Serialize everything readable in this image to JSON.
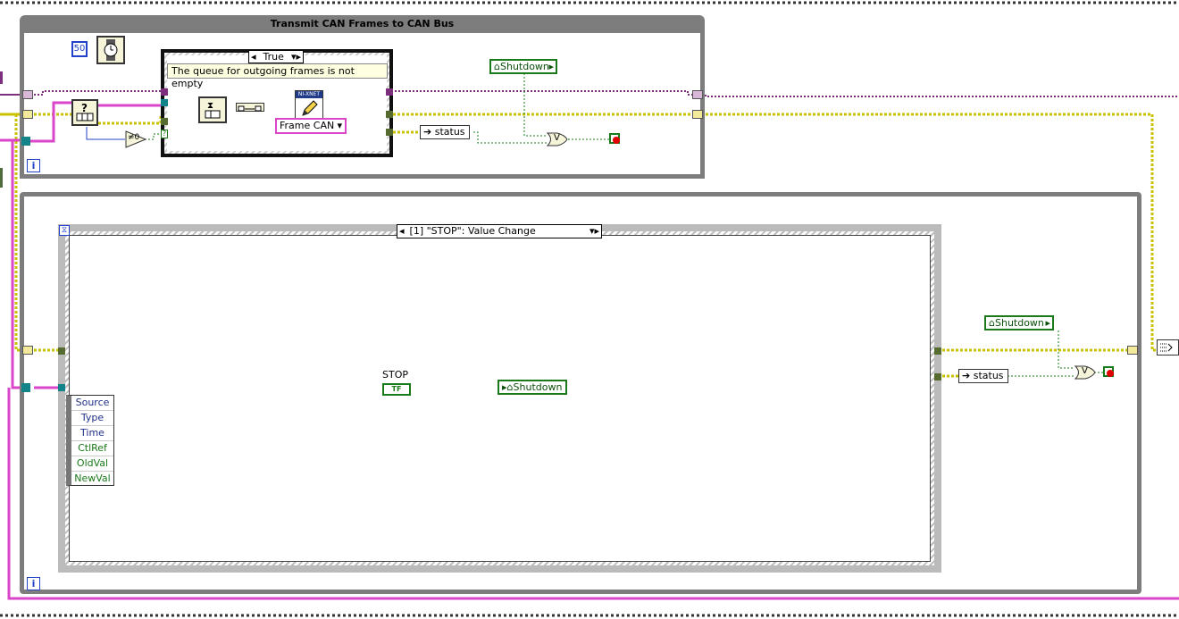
{
  "top_loop": {
    "title": "Transmit CAN Frames to CAN Bus",
    "iteration_label": "i",
    "wait_constant": "50"
  },
  "case_structure": {
    "selector_value": "True",
    "comment": "The queue for outgoing frames is not empty"
  },
  "xnet": {
    "badge": "NI-XNET",
    "mode_selector": "Frame CAN"
  },
  "top_status_label": "status",
  "top_shutdown_label": "Shutdown",
  "compare_label": "≠0",
  "bottom_loop": {
    "iteration_label": "i",
    "event_selector": "[1] \"STOP\": Value Change",
    "stop_caption": "STOP",
    "stop_terminal": "TF",
    "shutdown_local": "Shutdown",
    "event_data": [
      "Source",
      "Type",
      "Time",
      "CtlRef",
      "OldVal",
      "NewVal"
    ]
  },
  "right_shutdown_label": "Shutdown",
  "right_status_label": "status",
  "or_label": "V",
  "colors": {
    "loop_border": "#7d7d7d",
    "wire_pink": "#d946c8",
    "wire_yellow": "#c8c200",
    "wire_purple": "#7d2e7d",
    "wire_green": "#1a7a1a",
    "wire_blue": "#2243c9"
  }
}
